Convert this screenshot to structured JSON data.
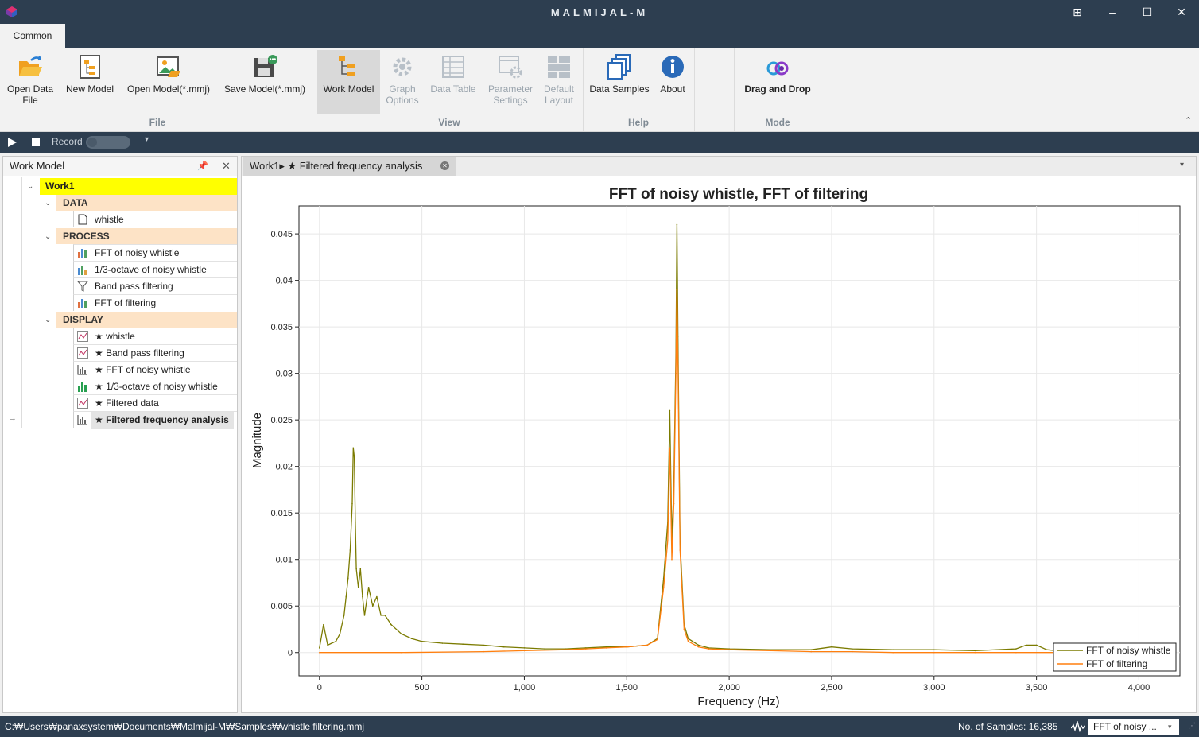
{
  "window": {
    "title": "MALMIJAL-M"
  },
  "ribbon": {
    "tab": "Common",
    "groups": {
      "file": "File",
      "view": "View",
      "help": "Help",
      "mode": "Mode"
    },
    "buttons": {
      "open_data_file": "Open Data\nFile",
      "new_model": "New Model",
      "open_model": "Open Model(*.mmj)",
      "save_model": "Save Model(*.mmj)",
      "work_model": "Work Model",
      "graph_options": "Graph\nOptions",
      "data_table": "Data Table",
      "parameter_settings": "Parameter\nSettings",
      "default_layout": "Default\nLayout",
      "data_samples": "Data Samples",
      "about": "About",
      "drag_and_drop": "Drag and Drop"
    }
  },
  "playbar": {
    "record_label": "Record"
  },
  "work_model": {
    "title": "Work Model",
    "root": "Work1",
    "categories": {
      "data": "DATA",
      "process": "PROCESS",
      "display": "DISPLAY"
    },
    "data_items": [
      "whistle"
    ],
    "process_items": [
      "FFT of noisy whistle",
      "1/3-octave of noisy whistle",
      "Band pass filtering",
      "FFT of filtering"
    ],
    "display_items": [
      "★ whistle",
      "★ Band pass filtering",
      "★ FFT of noisy whistle",
      "★ 1/3-octave of noisy whistle",
      "★ Filtered data",
      "★ Filtered frequency analysis"
    ]
  },
  "document": {
    "tab_label": "Work1▸ ★ Filtered frequency analysis"
  },
  "status": {
    "path": "C:₩Users₩panaxsystem₩Documents₩Malmijal-M₩Samples₩whistle filtering.mmj",
    "samples": "No. of Samples: 16,385",
    "selector": "FFT of noisy ..."
  },
  "colors": {
    "titlebar": "#2d3e50",
    "series_noisy": "#7b7b00",
    "series_filtered": "#ff7f0e",
    "root_highlight": "#ffff00",
    "category_bg": "#fde3c6"
  },
  "chart_data": {
    "type": "line",
    "title": "FFT of noisy whistle, FFT of filtering",
    "xlabel": "Frequency (Hz)",
    "ylabel": "Magnitude",
    "xlim": [
      -100,
      4200
    ],
    "ylim": [
      -0.0025,
      0.048
    ],
    "xticks": [
      0,
      500,
      1000,
      1500,
      2000,
      2500,
      3000,
      3500,
      4000
    ],
    "xtick_labels": [
      "0",
      "500",
      "1,000",
      "1,500",
      "2,000",
      "2,500",
      "3,000",
      "3,500",
      "4,000"
    ],
    "yticks": [
      0,
      0.005,
      0.01,
      0.015,
      0.02,
      0.025,
      0.03,
      0.035,
      0.04,
      0.045
    ],
    "ytick_labels": [
      "0",
      "0.005",
      "0.01",
      "0.015",
      "0.02",
      "0.025",
      "0.03",
      "0.035",
      "0.04",
      "0.045"
    ],
    "grid": true,
    "legend_position": "bottom-right",
    "series": [
      {
        "name": "FFT of noisy whistle",
        "color": "#7b7b00",
        "x": [
          0,
          20,
          40,
          60,
          80,
          100,
          120,
          130,
          140,
          150,
          160,
          165,
          170,
          175,
          180,
          190,
          200,
          210,
          220,
          240,
          260,
          280,
          300,
          320,
          350,
          400,
          450,
          500,
          600,
          700,
          800,
          900,
          1000,
          1100,
          1200,
          1300,
          1400,
          1500,
          1600,
          1650,
          1680,
          1700,
          1710,
          1720,
          1730,
          1740,
          1745,
          1750,
          1760,
          1780,
          1800,
          1850,
          1900,
          2000,
          2200,
          2400,
          2500,
          2600,
          2800,
          3000,
          3200,
          3400,
          3450,
          3500,
          3550,
          3600
        ],
        "y": [
          0.0005,
          0.003,
          0.0008,
          0.001,
          0.0012,
          0.002,
          0.004,
          0.006,
          0.008,
          0.011,
          0.016,
          0.022,
          0.021,
          0.014,
          0.009,
          0.007,
          0.009,
          0.006,
          0.004,
          0.007,
          0.005,
          0.006,
          0.004,
          0.004,
          0.003,
          0.002,
          0.0015,
          0.0012,
          0.001,
          0.0009,
          0.0008,
          0.0006,
          0.0005,
          0.0004,
          0.0004,
          0.0005,
          0.0006,
          0.0006,
          0.0008,
          0.0015,
          0.008,
          0.014,
          0.026,
          0.012,
          0.018,
          0.032,
          0.046,
          0.034,
          0.012,
          0.003,
          0.0015,
          0.0008,
          0.0005,
          0.0004,
          0.0003,
          0.0003,
          0.0006,
          0.0004,
          0.0003,
          0.0003,
          0.0002,
          0.0004,
          0.0008,
          0.0008,
          0.0003,
          0.0002
        ]
      },
      {
        "name": "FFT of filtering",
        "color": "#ff7f0e",
        "x": [
          0,
          400,
          800,
          1000,
          1200,
          1300,
          1400,
          1500,
          1600,
          1650,
          1680,
          1700,
          1710,
          1720,
          1730,
          1740,
          1745,
          1750,
          1760,
          1780,
          1800,
          1850,
          1900,
          2000,
          2200,
          2400,
          2600,
          2800,
          3000,
          3200,
          3400,
          3600
        ],
        "y": [
          0,
          0,
          0.0001,
          0.0002,
          0.0003,
          0.0004,
          0.0005,
          0.0006,
          0.0008,
          0.0014,
          0.007,
          0.012,
          0.022,
          0.01,
          0.016,
          0.03,
          0.039,
          0.031,
          0.011,
          0.0025,
          0.0012,
          0.0006,
          0.0004,
          0.0003,
          0.0002,
          0.0001,
          0.0001,
          0,
          0,
          0,
          0,
          0
        ]
      }
    ]
  }
}
